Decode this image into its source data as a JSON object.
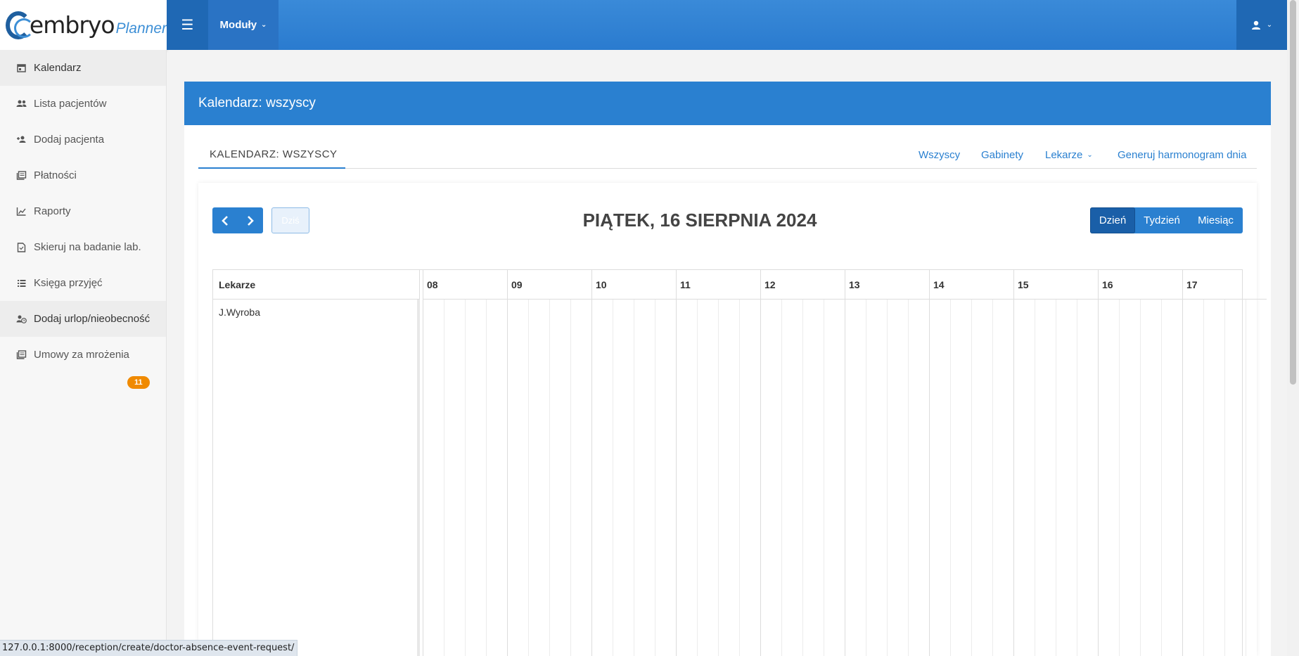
{
  "header": {
    "logo_main": "embryo",
    "logo_sub": "Planner",
    "modules_label": "Moduły"
  },
  "sidebar": {
    "items": [
      {
        "label": "Kalendarz",
        "icon": "calendar-icon"
      },
      {
        "label": "Lista pacjentów",
        "icon": "users-icon"
      },
      {
        "label": "Dodaj pacjenta",
        "icon": "user-plus-icon"
      },
      {
        "label": "Płatności",
        "icon": "payments-icon"
      },
      {
        "label": "Raporty",
        "icon": "chart-icon"
      },
      {
        "label": "Skieruj na badanie lab.",
        "icon": "document-icon"
      },
      {
        "label": "Księga przyjęć",
        "icon": "list-icon"
      },
      {
        "label": "Dodaj urlop/nieobecność",
        "icon": "user-clock-icon"
      },
      {
        "label": "Umowy za mrożenia",
        "icon": "contracts-icon"
      }
    ],
    "badge": "11"
  },
  "panel": {
    "title": "Kalendarz: wszyscy",
    "tab_active": "KALENDARZ: WSZYSCY",
    "links": [
      "Wszyscy",
      "Gabinety",
      "Lekarze",
      "Generuj harmonogram dnia"
    ]
  },
  "calendar": {
    "today_label": "Dziś",
    "title": "PIĄTEK, 16 SIERPNIA 2024",
    "views": [
      "Dzień",
      "Tydzień",
      "Miesiąc"
    ],
    "active_view": "Dzień",
    "resource_header": "Lekarze",
    "resources": [
      "J.Wyroba"
    ],
    "hours": [
      "08",
      "09",
      "10",
      "11",
      "12",
      "13",
      "14",
      "15",
      "16",
      "17"
    ]
  },
  "status_bar": {
    "url": "127.0.0.1:8000/reception/create/doctor-absence-event-request/"
  },
  "colors": {
    "primary": "#2a80d0",
    "dark_primary": "#1f68b4",
    "badge": "#f08a00"
  }
}
